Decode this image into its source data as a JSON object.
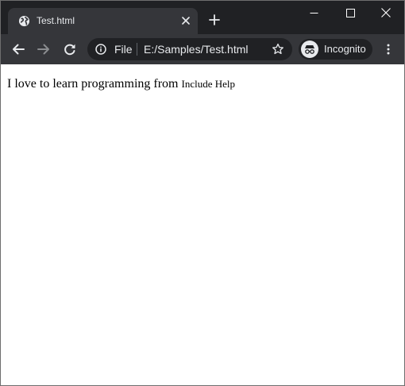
{
  "tab": {
    "title": "Test.html",
    "favicon": "globe-icon"
  },
  "window_controls": {
    "minimize": "minimize-icon",
    "maximize": "maximize-icon",
    "close": "close-icon"
  },
  "toolbar": {
    "back": "arrow-left-icon",
    "forward": "arrow-right-icon",
    "reload": "reload-icon",
    "address": {
      "scheme_label": "File",
      "url": "E:/Samples/Test.html"
    },
    "incognito_label": "Incognito"
  },
  "page": {
    "text": "I love to learn programming from",
    "small_text": "Include Help"
  },
  "colors": {
    "titlebar": "#202124",
    "toolbar": "#35363a",
    "omnibox": "#202124",
    "text_light": "#e8eaed"
  }
}
